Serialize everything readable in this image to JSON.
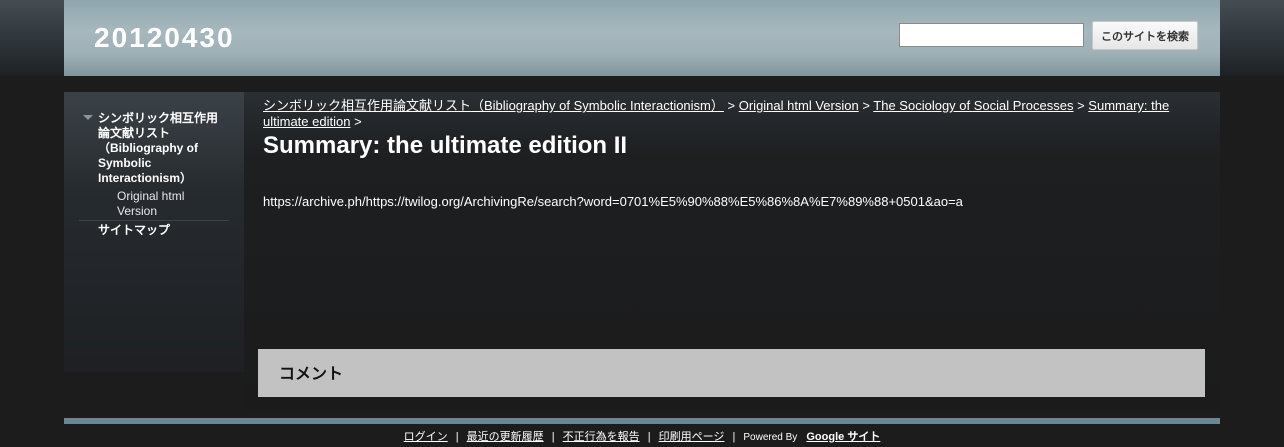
{
  "header": {
    "site_title": "20120430",
    "search_button": "このサイトを検索"
  },
  "sidebar": {
    "items": [
      {
        "label": "シンボリック相互作用論文献リスト（Bibliography of Symbolic Interactionism）"
      },
      {
        "label": "Original html Version"
      },
      {
        "label": "サイトマップ"
      }
    ]
  },
  "breadcrumb": {
    "items": [
      {
        "label": "シンボリック相互作用論文献リスト（Bibliography of Symbolic Interactionism）"
      },
      {
        "label": "Original html Version"
      },
      {
        "label": "The Sociology of Social Processes"
      },
      {
        "label": "Summary: the ultimate edition"
      }
    ],
    "separator": ">"
  },
  "main": {
    "title": "Summary: the ultimate edition II",
    "text": "https://archive.ph/https://twilog.org/ArchivingRe/search?word=0701%E5%90%88%E5%86%8A%E7%89%88+0501&ao=a"
  },
  "comments": {
    "title": "コメント"
  },
  "footer": {
    "links": [
      {
        "label": "ログイン"
      },
      {
        "label": "最近の更新履歴"
      },
      {
        "label": "不正行為を報告"
      },
      {
        "label": "印刷用ページ"
      }
    ],
    "separator": "|",
    "powered_by": "Powered By",
    "google_sites": "Google サイト"
  }
}
